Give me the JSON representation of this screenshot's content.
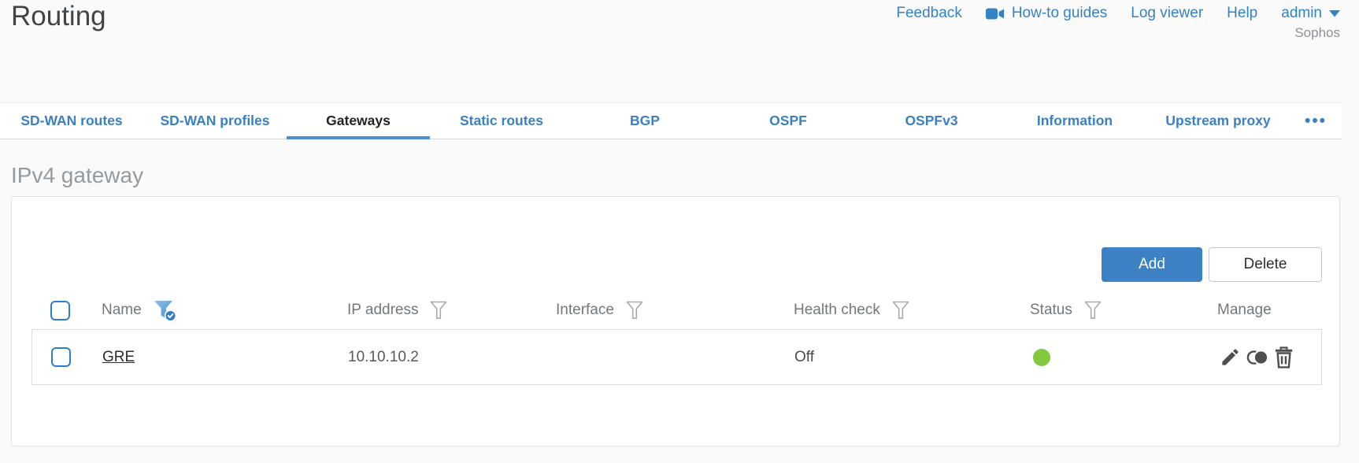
{
  "page": {
    "title": "Routing",
    "brand": "Sophos"
  },
  "top_nav": {
    "feedback": "Feedback",
    "howto_guides": "How-to guides",
    "log_viewer": "Log viewer",
    "help": "Help",
    "user": "admin"
  },
  "tabs": {
    "items": [
      {
        "label": "SD-WAN routes",
        "active": false
      },
      {
        "label": "SD-WAN profiles",
        "active": false
      },
      {
        "label": "Gateways",
        "active": true
      },
      {
        "label": "Static routes",
        "active": false
      },
      {
        "label": "BGP",
        "active": false
      },
      {
        "label": "OSPF",
        "active": false
      },
      {
        "label": "OSPFv3",
        "active": false
      },
      {
        "label": "Information",
        "active": false
      },
      {
        "label": "Upstream proxy",
        "active": false
      }
    ],
    "overflow_label": "•••"
  },
  "section": {
    "title": "IPv4 gateway"
  },
  "toolbar": {
    "add_label": "Add",
    "delete_label": "Delete"
  },
  "table": {
    "columns": {
      "name": "Name",
      "ip": "IP address",
      "interface": "Interface",
      "health": "Health check",
      "status": "Status",
      "manage": "Manage"
    },
    "filters": {
      "name": "active",
      "ip": "inactive",
      "interface": "inactive",
      "health": "inactive",
      "status": "inactive"
    },
    "rows": [
      {
        "name": "GRE",
        "ip": "10.10.10.2",
        "interface": "",
        "health": "Off",
        "status": "up",
        "actions": [
          "edit",
          "clone",
          "delete"
        ]
      }
    ]
  },
  "icons": {
    "howto": "video-camera-icon",
    "user_menu": "caret-down-icon",
    "filter": "funnel-icon",
    "filter_active": "funnel-check-icon",
    "edit": "pencil-icon",
    "clone": "overlapping-circles-icon",
    "delete": "trash-icon"
  },
  "colors": {
    "accent_blue": "#3d82c4",
    "link_blue": "#3482c6",
    "status_green": "#82c93d"
  }
}
